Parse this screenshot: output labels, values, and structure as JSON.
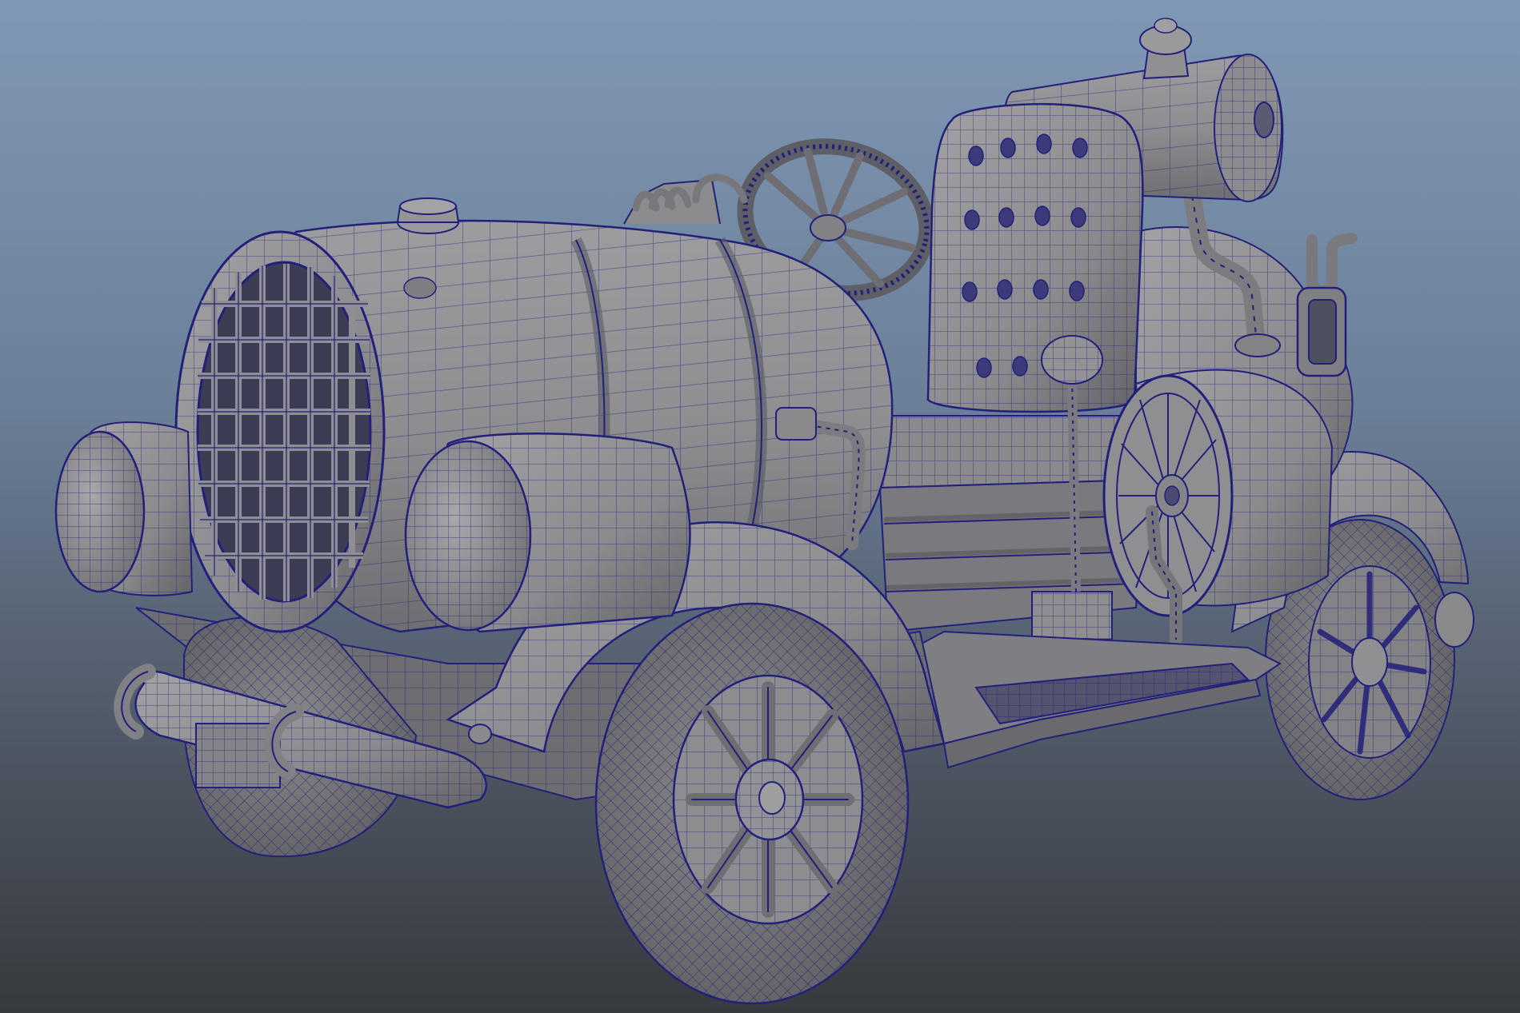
{
  "viewport": {
    "background_top": "#7f98b5",
    "background_bottom": "#373a3e",
    "shaded_surface": "#8f8f91",
    "shadow_surface": "#6c6c70",
    "wireframe": "#22207a"
  },
  "model": {
    "subject": "vintage-steam-car",
    "display_mode": "wireframe-on-shaded"
  }
}
